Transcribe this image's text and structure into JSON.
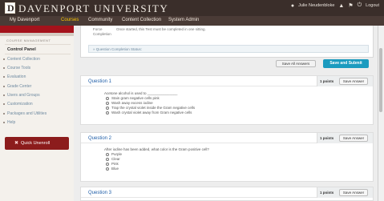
{
  "header": {
    "logo_letter": "D",
    "brand": "DAVENPORT UNIVERSITY",
    "user_name": "Julie Neudenbloke",
    "logout": "Logout"
  },
  "nav": {
    "items": [
      "My Davenport",
      "Courses",
      "Community",
      "Content Collection",
      "System Admin"
    ],
    "active": "Courses"
  },
  "sidebar": {
    "section_title": "COURSE MANAGEMENT",
    "control_panel": "Control Panel",
    "items": [
      "Content Collection",
      "Course Tools",
      "Evaluation",
      "Grade Center",
      "Users and Groups",
      "Customization",
      "Packages and Utilities",
      "Help"
    ],
    "quick_unenroll": "Quick Unenroll"
  },
  "top_info": {
    "label": "Force Completion",
    "text": "Once started, this Test must be completed in one sitting.",
    "completion_status": "» Question Completion Status:"
  },
  "actions": {
    "save_all": "Save All Answers",
    "save_submit": "Save and Submit"
  },
  "questions": [
    {
      "title": "Question 1",
      "points": "1 points",
      "save": "Save Answer",
      "prompt": "Acetone alcohol is used to _______________",
      "options": [
        "Stain gram negative cells pink",
        "Wash away excess iodine",
        "Trap the crystal violet inside the Gram negative cells",
        "Wash crystal violet away from Gram negative cells"
      ]
    },
    {
      "title": "Question 2",
      "points": "1 points",
      "save": "Save Answer",
      "prompt": "After iodine has been added, what color is the Gram positive cell?",
      "options": [
        "Purple",
        "Clear",
        "Pink",
        "Blue"
      ]
    },
    {
      "title": "Question 3",
      "points": "1 points",
      "save": "Save Answer"
    }
  ]
}
